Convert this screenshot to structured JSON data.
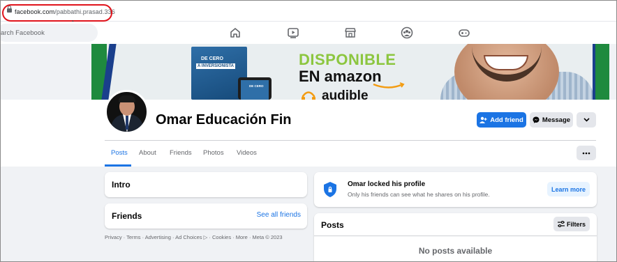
{
  "browser": {
    "url_domain": "facebook.com",
    "url_path": "/pabbathi.prasad.336"
  },
  "fb_nav": {
    "search_placeholder": "Search Facebook",
    "search_visible_text": "arch Facebook",
    "icons": [
      "home-icon",
      "video-icon",
      "marketplace-icon",
      "groups-icon",
      "gaming-icon"
    ]
  },
  "cover": {
    "book_title_line1": "DE CERO",
    "book_title_line2": "A INVERSIONISTA",
    "phone_text": "DE CERO",
    "headline1": "DISPONIBLE",
    "headline2": "EN amazon",
    "headline3": "audible"
  },
  "profile": {
    "name": "Omar Educación Fin",
    "add_friend_label": "Add friend",
    "message_label": "Message"
  },
  "tabs": [
    {
      "label": "Posts",
      "active": true
    },
    {
      "label": "About",
      "active": false
    },
    {
      "label": "Friends",
      "active": false
    },
    {
      "label": "Photos",
      "active": false
    },
    {
      "label": "Videos",
      "active": false
    }
  ],
  "left": {
    "intro_title": "Intro",
    "friends_title": "Friends",
    "see_all_friends": "See all friends",
    "footer": "Privacy · Terms · Advertising · Ad Choices ▷ · Cookies · More · Meta © 2023"
  },
  "locked": {
    "title": "Omar locked his profile",
    "subtitle": "Only his friends can see what he shares on his profile.",
    "learn_more": "Learn more"
  },
  "posts": {
    "title": "Posts",
    "filters_label": "Filters",
    "empty_text": "No posts available"
  },
  "colors": {
    "fb_blue": "#1b74e4",
    "highlight_red": "#e0131b",
    "cover_green": "#8cc63f"
  }
}
